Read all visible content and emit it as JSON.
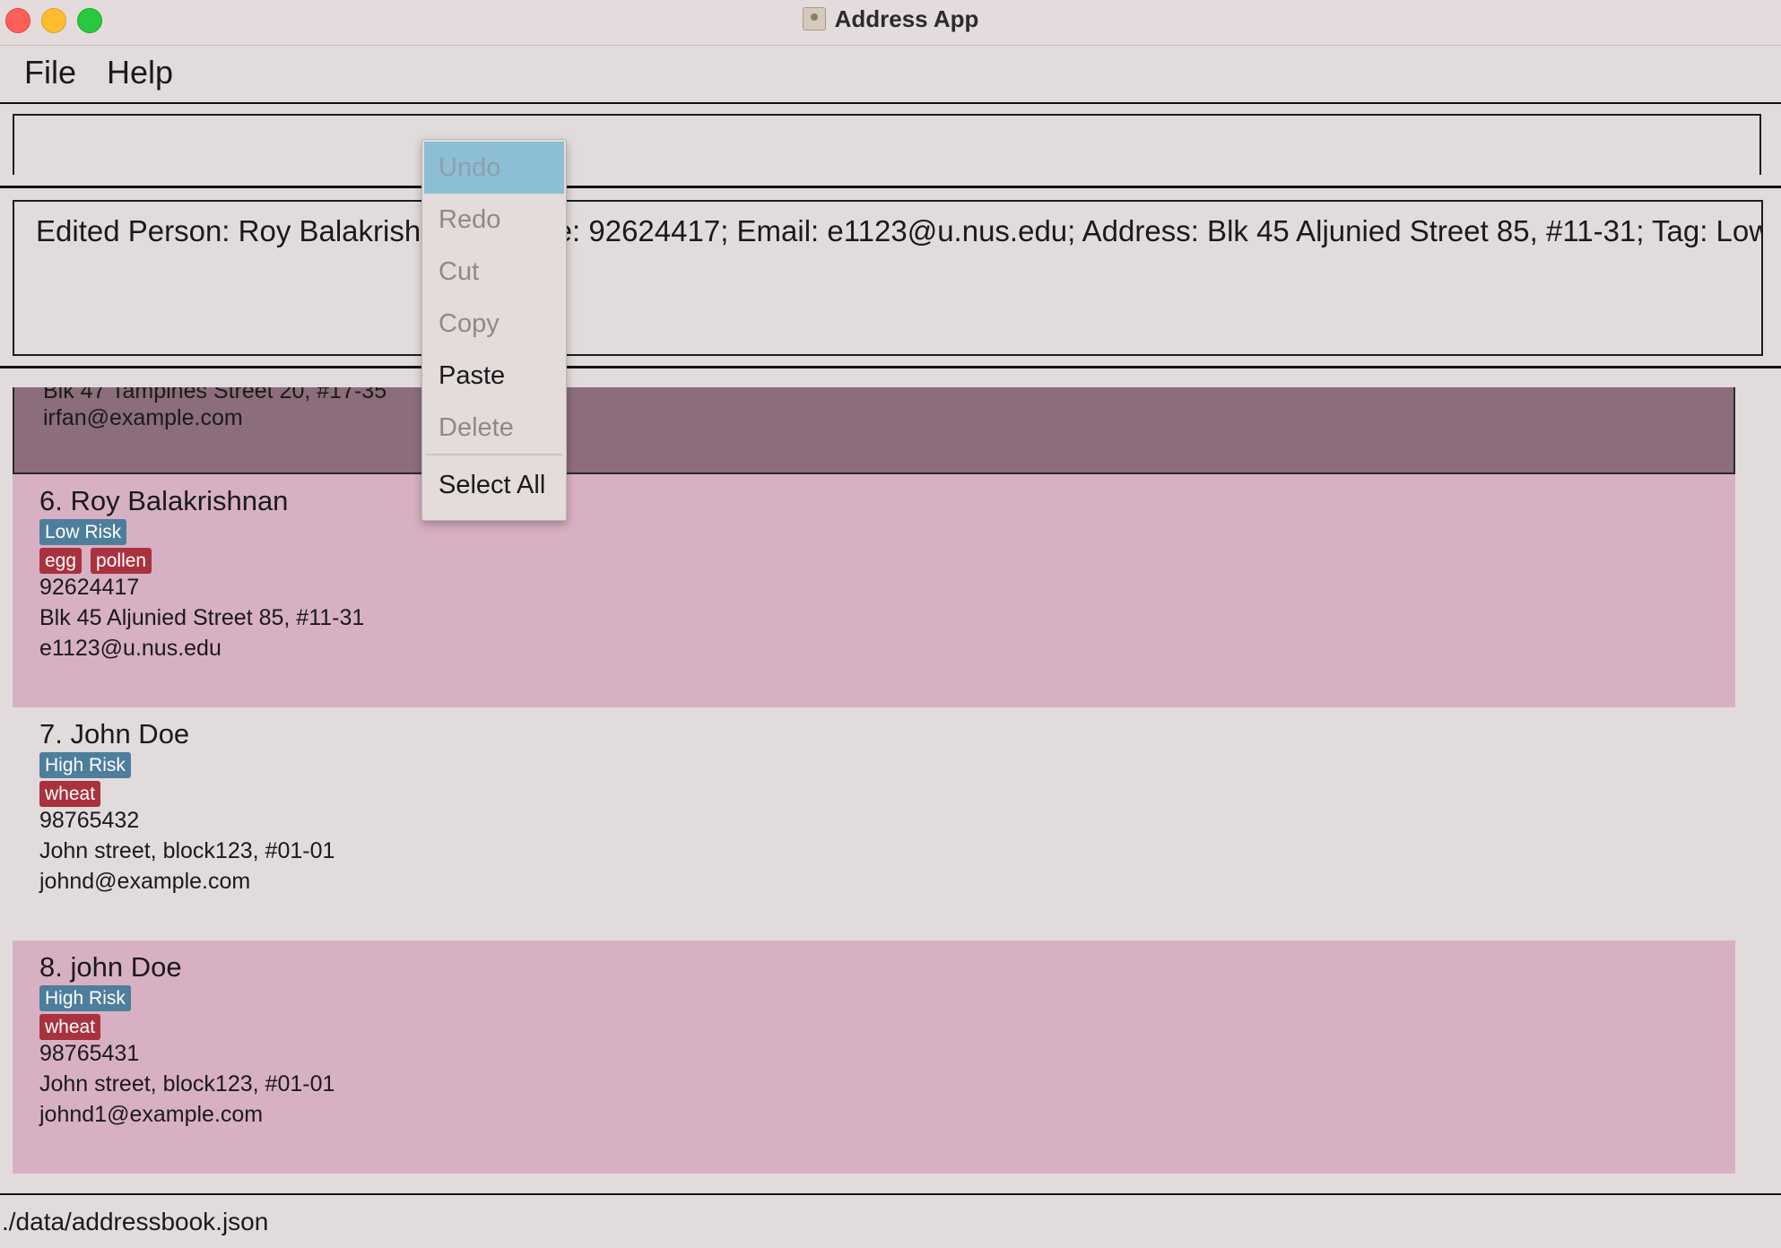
{
  "window": {
    "title": "Address App"
  },
  "menubar": {
    "file": "File",
    "help": "Help"
  },
  "command_box": {
    "value": ""
  },
  "result": {
    "text": "Edited Person: Roy Balakrishnan; Phone: 92624417; Email: e1123@u.nus.edu; Address: Blk 45 Aljunied Street 85, #11-31; Tag: Low Ri"
  },
  "persons": {
    "selected": {
      "address": "Blk 47 Tampines Street 20, #17-35",
      "email": "irfan@example.com"
    },
    "p6": {
      "name": "6. Roy Balakrishnan",
      "risk": "Low Risk",
      "tags": [
        "egg",
        "pollen"
      ],
      "phone": "92624417",
      "address": "Blk 45 Aljunied Street 85, #11-31",
      "email": "e1123@u.nus.edu"
    },
    "p7": {
      "name": "7. John Doe",
      "risk": "High Risk",
      "tags": [
        "wheat"
      ],
      "phone": "98765432",
      "address": "John street, block123, #01-01",
      "email": "johnd@example.com"
    },
    "p8": {
      "name": "8. john Doe",
      "risk": "High Risk",
      "tags": [
        "wheat"
      ],
      "phone": "98765431",
      "address": "John street, block123, #01-01",
      "email": "johnd1@example.com"
    }
  },
  "context_menu": {
    "undo": "Undo",
    "redo": "Redo",
    "cut": "Cut",
    "copy": "Copy",
    "paste": "Paste",
    "delete": "Delete",
    "select_all": "Select All"
  },
  "status_bar": {
    "path": "./data/addressbook.json"
  },
  "colors": {
    "card_alt": "#d8b0c3",
    "card_selected": "#8c6d7b",
    "risk_tag": "#4d7e9c",
    "allergy_tag": "#a8323d",
    "menu_highlight": "#8cbfd6"
  },
  "icons": {
    "app": "address-book-icon"
  }
}
